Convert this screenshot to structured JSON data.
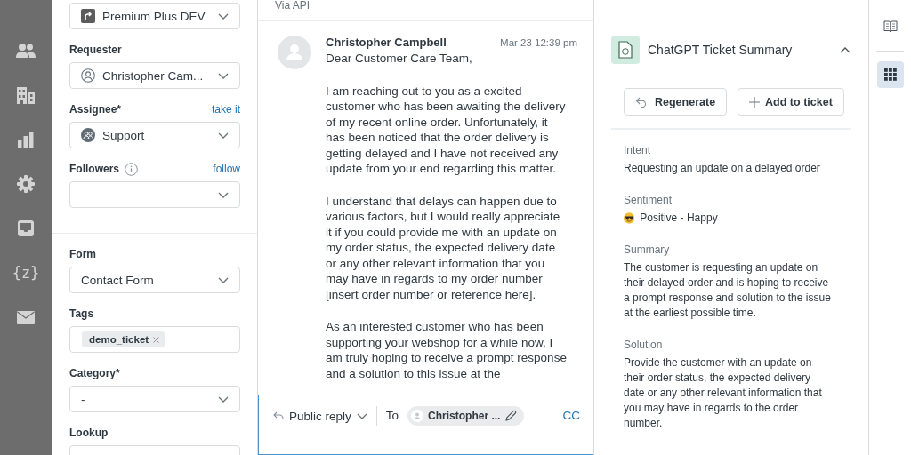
{
  "nav": [
    {
      "kind": "people"
    },
    {
      "kind": "building"
    },
    {
      "kind": "chart"
    },
    {
      "kind": "gear"
    },
    {
      "kind": "inbox"
    },
    {
      "kind": "text",
      "text": "{z}"
    },
    {
      "kind": "mail"
    }
  ],
  "properties": {
    "sections": [
      [
        {
          "kind": "select",
          "value": "Premium Plus DEV"
        },
        {
          "kind": "select",
          "label": "Requester",
          "value": "Christopher Cam..."
        },
        {
          "kind": "select",
          "label": "Assignee*",
          "link": "take it",
          "value": "Support"
        },
        {
          "kind": "select",
          "label": "Followers",
          "info": true,
          "link": "follow"
        }
      ],
      [
        {
          "kind": "select",
          "label": "Form",
          "value": "Contact Form"
        },
        {
          "kind": "tags",
          "label": "Tags",
          "tags": [
            "demo_ticket"
          ]
        },
        {
          "kind": "select",
          "label": "Category*",
          "value": "-"
        },
        {
          "kind": "select",
          "label": "Lookup"
        }
      ]
    ]
  },
  "conversation": {
    "via": "Via API",
    "message": {
      "author": "Christopher Campbell",
      "time": "Mar 23 12:39 pm",
      "paragraphs": [
        "Dear Customer Care Team,",
        "I am reaching out to you as a excited customer who has been awaiting the delivery of my recent online order. Unfortunately, it has been noticed that the order delivery is getting delayed and I have not received any update from your end regarding this matter.",
        "I understand that delays can happen due to various factors, but I would really appreciate it if you could provide me with an update on my order status, the expected delivery date or any other relevant information that you may have in regards to my order number [insert order number or reference here].",
        "As an interested customer who has been supporting your webshop for a while now, I am truly hoping to receive a prompt response and a solution to this issue at the"
      ]
    },
    "composer": {
      "reply_type": "Public reply",
      "to_label": "To",
      "recipient": "Christopher ...",
      "cc": "CC"
    }
  },
  "app": {
    "title": "ChatGPT Ticket Summary",
    "expanded": true,
    "buttons": [
      {
        "kind": "regenerate",
        "label": "Regenerate"
      },
      {
        "kind": "add",
        "label": "Add to ticket"
      }
    ],
    "sections": [
      {
        "heading": "Intent",
        "text": "Requesting an update on a delayed order"
      },
      {
        "heading": "Sentiment",
        "text": "Positive - Happy"
      },
      {
        "heading": "Summary",
        "text": "The customer is requesting an update on their delayed order and is hoping to receive a prompt response and solution to the issue at the earliest possible time."
      },
      {
        "heading": "Solution",
        "text": "Provide the customer with an update on their order status, the expected delivery date or any other relevant information that you may have in regards to the order number."
      }
    ]
  },
  "rail": [
    {
      "kind": "book",
      "selected": false
    },
    {
      "kind": "apps",
      "selected": true
    }
  ]
}
